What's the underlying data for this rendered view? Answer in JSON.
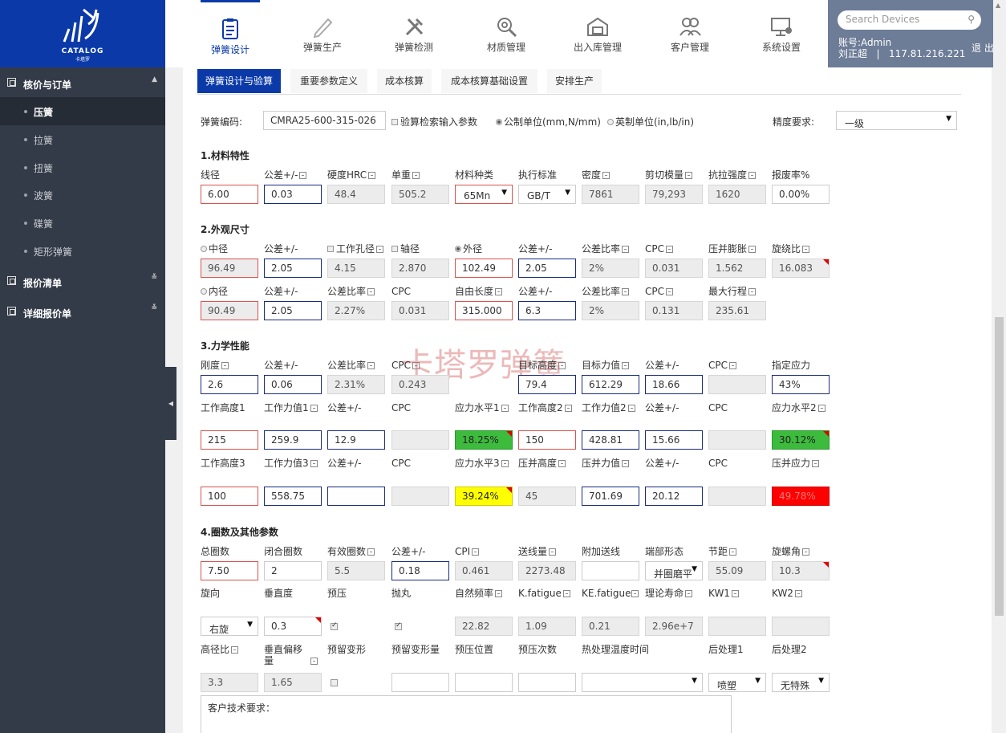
{
  "brand": {
    "name": "CATALOG",
    "sub": "卡塔罗"
  },
  "sidebar": {
    "group1": "核价与订单",
    "items": [
      "压簧",
      "拉簧",
      "扭簧",
      "波簧",
      "碟簧",
      "矩形弹簧"
    ],
    "group2": "报价清单",
    "group3": "详细报价单"
  },
  "nav": [
    "弹簧设计",
    "弹簧生产",
    "弹簧检测",
    "材质管理",
    "出入库管理",
    "客户管理",
    "系统设置"
  ],
  "user": {
    "search_placeholder": "Search Devices",
    "account": "账号:Admin",
    "name": "刘正超",
    "separator": "|",
    "ip": "117.81.216.221",
    "logout": "退 出"
  },
  "tabs": [
    "弹簧设计与验算",
    "重要参数定义",
    "成本核算",
    "成本核算基础设置",
    "安排生产"
  ],
  "head": {
    "code_label": "弹簧编码:",
    "code": "CMRA25-600-315-026",
    "check_label": "验算检索输入参数",
    "metric": "公制单位(mm,N/mm)",
    "imperial": "英制单位(in,lb/in)",
    "precision_label": "精度要求:",
    "precision": "一级"
  },
  "watermark": "卡塔罗弹簧",
  "s1": {
    "title": "1.材料特性",
    "labels": [
      "线径",
      "公差+/-",
      "硬度HRC",
      "单重",
      "材料种类",
      "执行标准",
      "密度",
      "剪切模量",
      "抗拉强度",
      "报废率%"
    ],
    "values": [
      "6.00",
      "0.03",
      "48.4",
      "505.2",
      "65Mn",
      "GB/T",
      "7861",
      "79,293",
      "1620",
      "0.00%"
    ]
  },
  "s2": {
    "title": "2.外观尺寸",
    "r1_labels": [
      "中径",
      "公差+/-",
      "工作孔径",
      "轴径",
      "外径",
      "公差+/-",
      "公差比率",
      "CPC",
      "压并膨胀",
      "旋绕比"
    ],
    "r1_values": [
      "96.49",
      "2.05",
      "4.15",
      "2.870",
      "102.49",
      "2.05",
      "2%",
      "0.031",
      "1.562",
      "16.083"
    ],
    "r2_labels": [
      "内径",
      "公差+/-",
      "公差比率",
      "CPC",
      "自由长度",
      "公差+/-",
      "公差比率",
      "CPC",
      "最大行程"
    ],
    "r2_values": [
      "90.49",
      "2.05",
      "2.27%",
      "0.031",
      "315.000",
      "6.3",
      "2%",
      "0.131",
      "235.61"
    ]
  },
  "s3": {
    "title": "3.力学性能",
    "r1_labels": [
      "刚度",
      "公差+/-",
      "公差比率",
      "CPC",
      "目标高度",
      "目标力值",
      "公差+/-",
      "CPC",
      "指定应力"
    ],
    "r1_values": [
      "2.6",
      "0.06",
      "2.31%",
      "0.243",
      "79.4",
      "612.29",
      "18.66",
      "",
      "43%"
    ],
    "r2_labels": [
      "工作高度1",
      "工作力值1",
      "公差+/-",
      "CPC",
      "应力水平1",
      "工作高度2",
      "工作力值2",
      "公差+/-",
      "CPC",
      "应力水平2"
    ],
    "r2_values": [
      "215",
      "259.9",
      "12.9",
      "",
      "18.25%",
      "150",
      "428.81",
      "15.66",
      "",
      "30.12%"
    ],
    "r3_labels": [
      "工作高度3",
      "工作力值3",
      "公差+/-",
      "CPC",
      "应力水平3",
      "压并高度",
      "压并力值",
      "公差+/-",
      "CPC",
      "压并应力"
    ],
    "r3_values": [
      "100",
      "558.75",
      "",
      "",
      "39.24%",
      "45",
      "701.69",
      "20.12",
      "",
      "49.78%"
    ]
  },
  "s4": {
    "title": "4.圈数及其他参数",
    "r1_labels": [
      "总圈数",
      "闭合圈数",
      "有效圈数",
      "公差+/-",
      "CPI",
      "送线量",
      "附加送线",
      "端部形态",
      "节距",
      "旋螺角"
    ],
    "r1_values": [
      "7.50",
      "2",
      "5.5",
      "0.18",
      "0.461",
      "2273.48",
      "",
      "并圈磨平",
      "55.09",
      "10.3"
    ],
    "r2_labels": [
      "旋向",
      "垂直度",
      "预压",
      "抛丸",
      "自然频率",
      "K.fatigue",
      "KE.fatigue",
      "理论寿命",
      "KW1",
      "KW2"
    ],
    "r2_values": [
      "右旋",
      "0.3",
      "",
      "",
      "22.82",
      "1.09",
      "0.21",
      "2.96e+7",
      "",
      ""
    ],
    "r3_labels": [
      "高径比",
      "垂直偏移量",
      "预留变形",
      "预留变形量",
      "预压位置",
      "预压次数",
      "热处理温度时间",
      "后处理1",
      "后处理2"
    ],
    "r3_values": [
      "3.3",
      "1.65",
      "",
      "",
      "",
      "",
      "",
      "喷塑",
      "无特殊"
    ]
  },
  "customer": {
    "label": "客户技术要求："
  }
}
